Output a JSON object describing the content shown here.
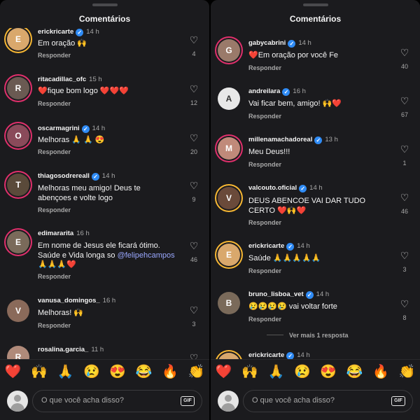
{
  "left_panel": {
    "title": "Comentários",
    "comments": [
      {
        "username": "erickricarte",
        "verified": true,
        "time": "14 h",
        "text": "Em oração 🙌",
        "reply": "Responder",
        "likes": "4"
      },
      {
        "username": "ritacadillac_ofc",
        "verified": false,
        "time": "15 h",
        "text": "❤️fique bom logo ❤️❤️❤️",
        "reply": "Responder",
        "likes": "12"
      },
      {
        "username": "oscarmagrini",
        "verified": true,
        "time": "14 h",
        "text": "Melhoras 🙏 🙏 😍",
        "reply": "Responder",
        "likes": "20"
      },
      {
        "username": "thiagosodrereall",
        "verified": true,
        "time": "14 h",
        "text": "Melhoras meu amigo! Deus te abençoes e volte logo",
        "reply": "Responder",
        "likes": "9"
      },
      {
        "username": "edimararita",
        "verified": false,
        "time": "16 h",
        "text": "Em nome de Jesus ele ficará ótimo. Saúde e Vida longa so",
        "mention": "@felipehcampos",
        "text_after": " 🙏🙏🙏❤️",
        "reply": "Responder",
        "likes": "46"
      },
      {
        "username": "vanusa_domingos_",
        "verified": false,
        "time": "16 h",
        "text": "Melhoras! 🙌",
        "reply": "Responder",
        "likes": "3"
      },
      {
        "username": "rosalina.garcia_",
        "verified": false,
        "time": "11 h",
        "text": "",
        "reply": "",
        "likes": ""
      }
    ],
    "emojis": [
      "❤️",
      "🙌",
      "🙏",
      "😢",
      "😍",
      "😂",
      "🔥",
      "👏"
    ],
    "input_placeholder": "O que você acha disso?",
    "gif_label": "GIF"
  },
  "right_panel": {
    "title": "Comentários",
    "comments": [
      {
        "username": "gabycabrini",
        "verified": true,
        "time": "14 h",
        "text": "❤️Em oração por você Fe",
        "reply": "Responder",
        "likes": "40"
      },
      {
        "username": "andreilara",
        "verified": true,
        "time": "16 h",
        "text": "Vai ficar bem, amigo! 🙌❤️",
        "reply": "Responder",
        "likes": "67"
      },
      {
        "username": "millenamachadoreal",
        "verified": true,
        "time": "13 h",
        "text": "Meu Deus!!!",
        "reply": "Responder",
        "likes": "1"
      },
      {
        "username": "valcouto.oficial",
        "verified": true,
        "time": "14 h",
        "text": "DEUS ABENCOE VAI DAR TUDO CERTO ❤️🙌❤️",
        "reply": "Responder",
        "likes": "46"
      },
      {
        "username": "erickricarte",
        "verified": true,
        "time": "14 h",
        "text": "Saúde 🙏🙏🙏🙏🙏",
        "reply": "Responder",
        "likes": "3"
      },
      {
        "username": "bruno_lisboa_vet",
        "verified": true,
        "time": "14 h",
        "text": "😢😢😢😢 vai voltar forte",
        "reply": "Responder",
        "likes": "8"
      },
      {
        "username": "erickricarte",
        "verified": true,
        "time": "14 h",
        "text": "",
        "reply": "",
        "likes": ""
      }
    ],
    "more_replies": "Ver mais 1 resposta",
    "emojis": [
      "❤️",
      "🙌",
      "🙏",
      "😢",
      "😍",
      "😂",
      "🔥",
      "👏"
    ],
    "input_placeholder": "O que você acha disso?",
    "gif_label": "GIF"
  },
  "colors": {
    "background": "#1b1b1e",
    "verified": "#2f8bf5",
    "mention": "#9aa8ff",
    "muted_text": "#a8a8a8",
    "story_ring": "#e1306c"
  },
  "icons": [
    "heart-outline-icon",
    "verified-badge-icon",
    "gif-icon",
    "avatar-placeholder-icon"
  ]
}
